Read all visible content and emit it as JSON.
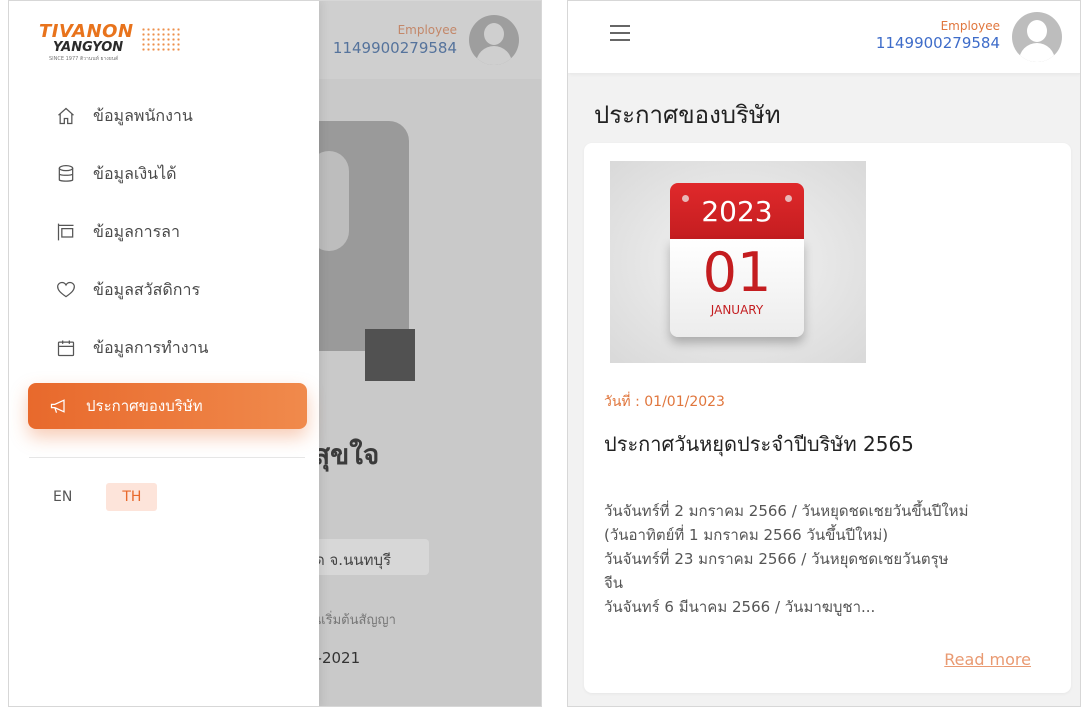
{
  "left": {
    "background": {
      "employee_label": "Employee",
      "employee_id": "1149900279584",
      "name_partial": "สุขใจ",
      "province_partial": "ด จ.นนทบุรี",
      "contract_label_partial": "วันเริ่มต้นสัญญา",
      "year_partial": "2-2021"
    },
    "logo": {
      "line1": "TIVANON",
      "line2": "YANGYON",
      "line3": "SINCE 1977 ติวานนท์ ยางยนต์"
    },
    "menu": [
      {
        "label": "ข้อมูลพนักงาน",
        "icon": "home-icon"
      },
      {
        "label": "ข้อมูลเงินได้",
        "icon": "database-icon"
      },
      {
        "label": "ข้อมูลการลา",
        "icon": "signboard-icon"
      },
      {
        "label": "ข้อมูลสวัสดิการ",
        "icon": "heart-icon"
      },
      {
        "label": "ข้อมูลการทำงาน",
        "icon": "calendar-icon"
      },
      {
        "label": "ประกาศของบริษัท",
        "icon": "megaphone-icon",
        "active": true
      }
    ],
    "languages": {
      "en": "EN",
      "th": "TH",
      "selected": "TH"
    }
  },
  "right": {
    "header": {
      "employee_label": "Employee",
      "employee_id": "1149900279584"
    },
    "page_title": "ประกาศของบริษัท",
    "announcement": {
      "calendar_year": "2023",
      "calendar_day": "01",
      "calendar_month": "JANUARY",
      "date": "วันที่ : 01/01/2023",
      "title": "ประกาศวันหยุดประจำปีบริษัท 2565",
      "body_lines": [
        "วันจันทร์ที่ 2 มกราคม 2566 / วันหยุดชดเชยวันขึ้นปีใหม่",
        "(วันอาทิตย์ที่ 1 มกราคม 2566 วันขึ้นปีใหม่)",
        "วันจันทร์ที่ 23 มกราคม 2566 / วันหยุดชดเชยวันตรุษ",
        "จีน",
        "วันจันทร์ 6 มีนาคม 2566 / วันมาฆบูชา..."
      ],
      "read_more": "Read more"
    }
  },
  "colors": {
    "accent": "#e8692c",
    "employee_id": "#3e6cc9",
    "calendar_red": "#c41d20"
  }
}
